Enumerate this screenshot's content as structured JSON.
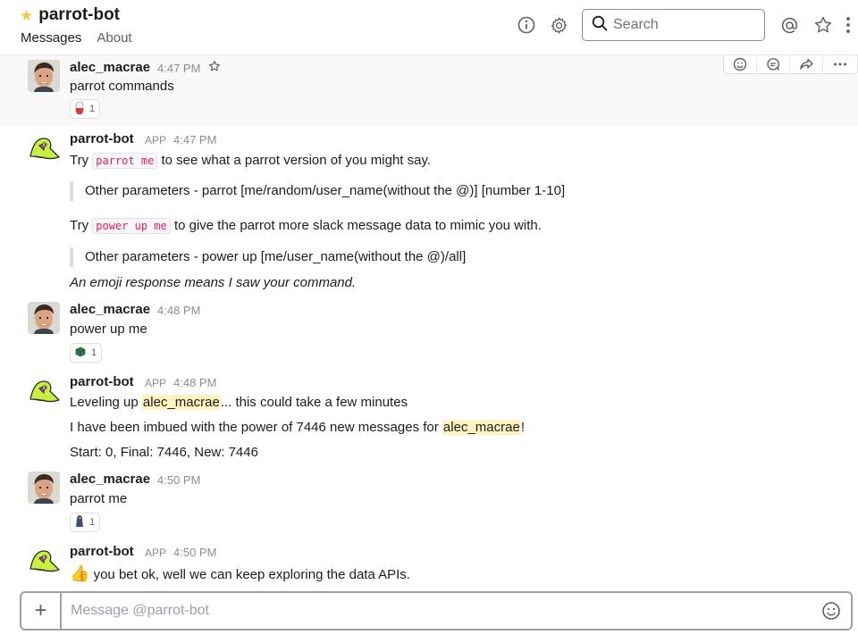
{
  "header": {
    "star_glyph": "★",
    "channel_name": "parrot-bot",
    "tabs": [
      {
        "label": "Messages",
        "active": true
      },
      {
        "label": "About",
        "active": false
      }
    ],
    "search_placeholder": "Search",
    "icons": [
      "info-icon",
      "gear-icon",
      "search-icon",
      "mention-icon",
      "star-icon",
      "more-vertical-icon"
    ]
  },
  "messages": [
    {
      "sender": "alec_macrae",
      "time": "4:47 PM",
      "text": "parrot commands",
      "reaction": {
        "emoji": "pill",
        "count": "1"
      }
    },
    {
      "sender": "parrot-bot",
      "app_tag": "APP",
      "time": "4:47 PM",
      "line1_pre": "Try",
      "line1_code": "parrot me",
      "line1_post": "to see what a parrot version of you might say.",
      "quote1": "Other parameters - parrot [me/random/user_name(without the @)] [number 1-10]",
      "line2_pre": "Try",
      "line2_code": "power up me",
      "line2_post": "to give the parrot more slack message data to mimic you with.",
      "quote2": "Other parameters - power up [me/user_name(without the @)/all]",
      "footer": "An emoji response means I saw your command."
    },
    {
      "sender": "alec_macrae",
      "time": "4:48 PM",
      "text": "power up me",
      "reaction": {
        "emoji": "package",
        "count": "1"
      }
    },
    {
      "sender": "parrot-bot",
      "app_tag": "APP",
      "time": "4:48 PM",
      "line1_pre": "Leveling up",
      "line1_mention": "alec_macrae",
      "line1_post": "... this could take a few minutes",
      "line2_pre": "I have been imbued with the power of 7446 new messages for",
      "line2_mention": "alec_macrae",
      "line2_post": "!",
      "line3": "Start: 0, Final: 7446, New: 7446"
    },
    {
      "sender": "alec_macrae",
      "time": "4:50 PM",
      "text": "parrot me",
      "reaction": {
        "emoji": "bird",
        "count": "1"
      }
    },
    {
      "sender": "parrot-bot",
      "app_tag": "APP",
      "time": "4:50 PM",
      "emoji": "👍",
      "text": "you bet ok, well we can keep exploring the data APIs."
    }
  ],
  "composer": {
    "placeholder": "Message @parrot-bot",
    "plus_glyph": "+"
  },
  "colors": {
    "mention_bg": "#fff4bf",
    "code_text": "#e01e5a",
    "parrot_green": "#c8f044",
    "parrot_pink": "#e23aa0",
    "star": "#f2c744"
  }
}
